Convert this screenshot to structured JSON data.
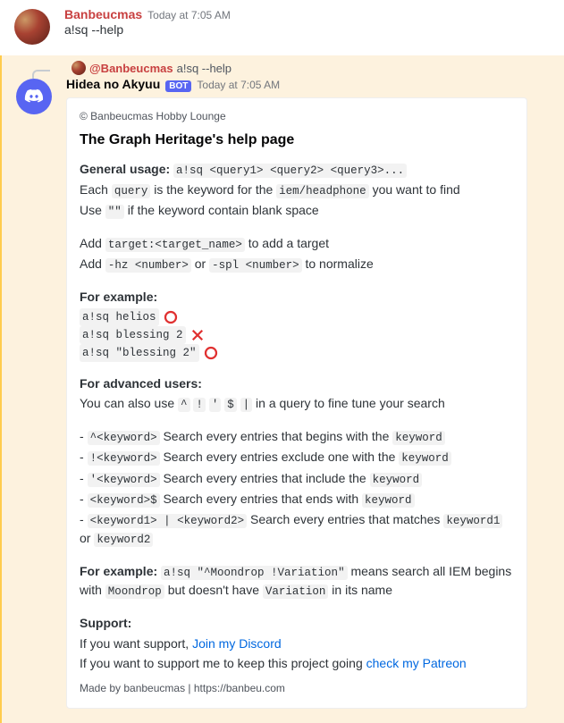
{
  "msg1": {
    "username": "Banbeucmas",
    "timestamp": "Today at 7:05 AM",
    "content": "a!sq --help"
  },
  "reply": {
    "mention": "@Banbeucmas",
    "text": "a!sq --help"
  },
  "bot": {
    "username": "Hidea no Akyuu",
    "badge": "BOT",
    "timestamp": "Today at 7:05 AM"
  },
  "embed": {
    "copyright": "© Banbeucmas Hobby Lounge",
    "title": "The Graph Heritage's help page",
    "general_label": "General usage:",
    "general_code": "a!sq <query1> <query2> <query3>...",
    "each_pre": "Each ",
    "each_code1": "query",
    "each_mid": " is the keyword for the ",
    "each_code2": "iem/headphone",
    "each_post": " you want to find",
    "use_pre": "Use ",
    "use_code": "\"\"",
    "use_post": " if the keyword contain blank space",
    "add1_pre": "Add ",
    "add1_code": "target:<target_name>",
    "add1_post": " to add a target",
    "add2_pre": "Add ",
    "add2_code1": "-hz <number>",
    "add2_mid": " or ",
    "add2_code2": "-spl <number>",
    "add2_post": " to normalize",
    "ex_label": "For example:",
    "ex1": "a!sq helios",
    "ex2": "a!sq blessing 2",
    "ex3": "a!sq \"blessing 2\"",
    "adv_label": "For advanced users:",
    "adv_pre": "You can also use ",
    "adv_c1": "^",
    "adv_c2": "!",
    "adv_c3": "'",
    "adv_c4": "$",
    "adv_c5": "|",
    "adv_post": " in a query to fine tune your search",
    "r1_dash": "- ",
    "r1_code": "^<keyword>",
    "r1_mid": " Search every entries that begins with the ",
    "r1_kw": "keyword",
    "r2_code": "!<keyword>",
    "r2_mid": " Search every entries exclude one with the ",
    "r2_kw": "keyword",
    "r3_code": "'<keyword>",
    "r3_mid": " Search every entries that include the ",
    "r3_kw": "keyword",
    "r4_code": "<keyword>$",
    "r4_mid": " Search every entries that ends with ",
    "r4_kw": "keyword",
    "r5_code": "<keyword1> | <keyword2>",
    "r5_mid": " Search every entries that matches ",
    "r5_kw1": "keyword1",
    "r5_or": " or ",
    "r5_kw2": "keyword2",
    "ex2_label": "For example:",
    "ex2_code": "a!sq \"^Moondrop !Variation\"",
    "ex2_mid": " means search all IEM begins with ",
    "ex2_c1": "Moondrop",
    "ex2_mid2": " but doesn't have ",
    "ex2_c2": "Variation",
    "ex2_post": " in its name",
    "support_label": "Support:",
    "support1_pre": "If you want support, ",
    "support1_link": "Join my Discord",
    "support2_pre": "If you want to support me to keep this project going ",
    "support2_link": "check my Patreon",
    "footer": "Made by banbeucmas | https://banbeu.com"
  }
}
